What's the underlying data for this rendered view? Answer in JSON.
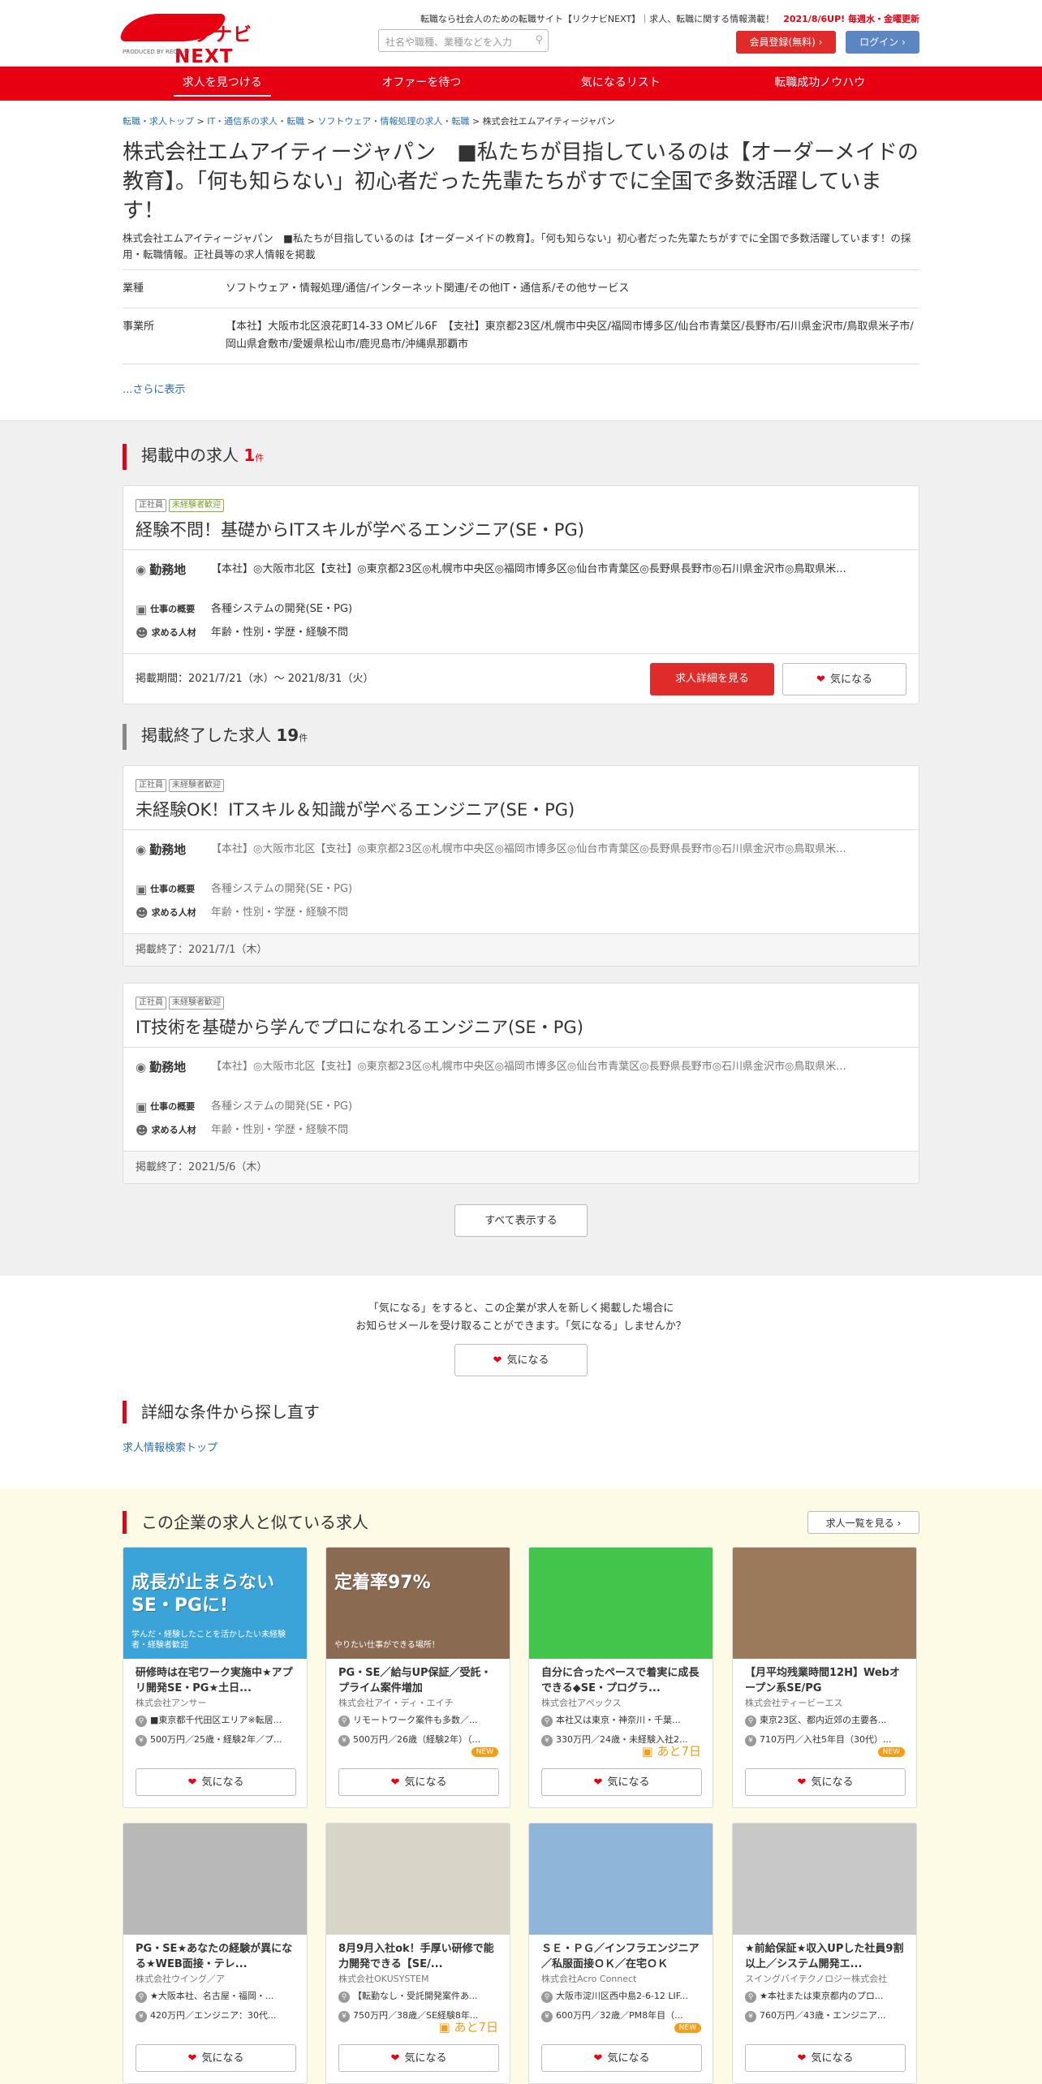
{
  "header": {
    "logo_text": "リクナビNEXT",
    "logo_sub": "PRODUCED BY RECRUIT",
    "tagline": "転職なら社会人のための転職サイト【リクナビNEXT】｜求人、転職に関する情報満載！",
    "update_note": "2021/8/6UP! 毎週水・金曜更新",
    "search_placeholder": "社名や職種、業種などを入力",
    "register_label": "会員登録(無料)",
    "login_label": "ログイン"
  },
  "nav": [
    "求人を見つける",
    "オファーを待つ",
    "気になるリスト",
    "転職成功ノウハウ"
  ],
  "breadcrumb": [
    "転職・求人トップ",
    "IT・通信系の求人・転職",
    "ソフトウェア・情報処理の求人・転職",
    "株式会社エムアイティージャパン"
  ],
  "company": {
    "title": "株式会社エムアイティージャパン　■私たちが目指しているのは【オーダーメイドの教育】。「何も知らない」初心者だった先輩たちがすでに全国で多数活躍しています！",
    "description": "株式会社エムアイティージャパン　■私たちが目指しているのは【オーダーメイドの教育】。「何も知らない」初心者だった先輩たちがすでに全国で多数活躍しています！の採用・転職情報。正社員等の求人情報を掲載",
    "industry_label": "業種",
    "industry": "ソフトウェア・情報処理/通信/インターネット関連/その他IT・通信系/その他サービス",
    "office_label": "事業所",
    "office": "【本社】大阪市北区浪花町14-33 OMビル6F　【支社】東京都23区/札幌市中央区/福岡市博多区/仙台市青葉区/長野市/石川県金沢市/鳥取県米子市/岡山県倉敷市/愛媛県松山市/鹿児島市/沖縄県那覇市",
    "more_label": "...さらに表示"
  },
  "active": {
    "heading": "掲載中の求人",
    "count": "1",
    "unit": "件",
    "job": {
      "tags": [
        "正社員",
        "未経験者歓迎"
      ],
      "title": "経験不問！基礎からITスキルが学べるエンジニア(SE・PG)",
      "loc_label": "勤務地",
      "loc": "【本社】◎大阪市北区【支社】◎東京都23区◎札幌市中央区◎福岡市博多区◎仙台市青葉区◎長野県長野市◎石川県金沢市◎鳥取県米...",
      "work_label": "仕事の概要",
      "work": "各種システムの開発(SE・PG)",
      "req_label": "求める人材",
      "req": "年齢・性別・学歴・経験不問",
      "period": "掲載期間：2021/7/21（水）～ 2021/8/31（火）",
      "detail_label": "求人詳細を見る",
      "fav_label": "気になる"
    }
  },
  "ended": {
    "heading": "掲載終了した求人",
    "count": "19",
    "unit": "件",
    "jobs": [
      {
        "tags": [
          "正社員",
          "未経験者歓迎"
        ],
        "title": "未経験OK！ITスキル＆知識が学べるエンジニア(SE・PG)",
        "loc_label": "勤務地",
        "loc": "【本社】◎大阪市北区【支社】◎東京都23区◎札幌市中央区◎福岡市博多区◎仙台市青葉区◎長野県長野市◎石川県金沢市◎鳥取県米...",
        "work_label": "仕事の概要",
        "work": "各種システムの開発(SE・PG)",
        "req_label": "求める人材",
        "req": "年齢・性別・学歴・経験不問",
        "end": "掲載終了：2021/7/1（木）"
      },
      {
        "tags": [
          "正社員",
          "未経験者歓迎"
        ],
        "title": "IT技術を基礎から学んでプロになれるエンジニア(SE・PG)",
        "loc_label": "勤務地",
        "loc": "【本社】◎大阪市北区【支社】◎東京都23区◎札幌市中央区◎福岡市博多区◎仙台市青葉区◎長野県長野市◎石川県金沢市◎鳥取県米...",
        "work_label": "仕事の概要",
        "work": "各種システムの開発(SE・PG)",
        "req_label": "求める人材",
        "req": "年齢・性別・学歴・経験不問",
        "end": "掲載終了：2021/5/6（木）"
      }
    ],
    "show_all_label": "すべて表示する"
  },
  "notice": {
    "line1": "「気になる」をすると、この企業が求人を新しく掲載した場合に",
    "line2": "お知らせメールを受け取ることができます。「気になる」しませんか？",
    "fav_label": "気になる"
  },
  "research": {
    "heading": "詳細な条件から探し直す",
    "link": "求人情報検索トップ"
  },
  "similar": {
    "heading": "この企業の求人と似ている求人",
    "see_all_label": "求人一覧を見る",
    "fav_label": "気になる",
    "items": [
      {
        "title": "研修時は在宅ワーク実施中★アプリ開発SE・PG★土日...",
        "company": "株式会社アンサー",
        "loc": "■東京都千代田区エリア※転居...",
        "salary": "500万円／25歳・経験2年／プ...",
        "badge": "",
        "img_text": "成長が止まらないSE・PGに!",
        "img_sub": "学んだ・経験したことを活かしたい未経験者・経験者歓迎",
        "color": "#3aa3d8"
      },
      {
        "title": "PG・SE／給与UP保証／受託・プライム案件増加",
        "company": "株式会社アイ・ディ・エイチ",
        "loc": "リモートワーク案件も多数／...",
        "salary": "500万円／26歳（経験2年）（...",
        "badge": "NEW",
        "img_text": "定着率97%",
        "img_sub": "やりたい仕事ができる場所！",
        "color": "#8a6a50"
      },
      {
        "title": "自分に合ったペースで着実に成長できる◆SE・プログラ...",
        "company": "株式会社アペックス",
        "loc": "本社又は東京・神奈川・千葉...",
        "salary": "330万円／24歳・未経験入社2...",
        "badge": "あと7日",
        "img_text": "",
        "img_sub": "",
        "color": "#43c44a"
      },
      {
        "title": "【月平均残業時間12H】Webオープン系SE/PG",
        "company": "株式会社ティービーエス",
        "loc": "東京23区、都内近郊の主要各...",
        "salary": "710万円／入社5年目（30代）...",
        "badge": "NEW",
        "img_text": "",
        "img_sub": "",
        "color": "#9a7a5a"
      },
      {
        "title": "PG・SE★あなたの経験が異になる★WEB面接・テレ...",
        "company": "株式会社ウイング／ア",
        "loc": "★大阪本社、名古屋・福岡・...",
        "salary": "420万円／エンジニア：30代...",
        "badge": "",
        "img_text": "",
        "img_sub": "",
        "color": "#b8b8b8"
      },
      {
        "title": "8月9月入社ok！手厚い研修で能力開発できる【SE/...",
        "company": "株式会社OKUSYSTEM",
        "loc": "【転勤なし・受託開発案件あ...",
        "salary": "750万円／38歳／SE経験8年...",
        "badge": "あと7日",
        "img_text": "",
        "img_sub": "",
        "color": "#d8d4c8"
      },
      {
        "title": "ＳＥ・ＰＧ／インフラエンジニア／私服面接ＯＫ／在宅ＯＫ",
        "company": "株式会社Acro Connect",
        "loc": "大阪市淀川区西中島2-6-12 LIF...",
        "salary": "600万円／32歳／PM8年目（...",
        "badge": "NEW",
        "img_text": "",
        "img_sub": "",
        "color": "#8fb6d8"
      },
      {
        "title": "★前給保証★収入UPした社員9割以上／システム開発エ...",
        "company": "スイングバイテクノロジー株式会社",
        "loc": "★本社または東京都内のプロ...",
        "salary": "760万円／43歳・エンジニア...",
        "badge": "",
        "img_text": "",
        "img_sub": "",
        "color": "#c8c8c8"
      }
    ]
  }
}
